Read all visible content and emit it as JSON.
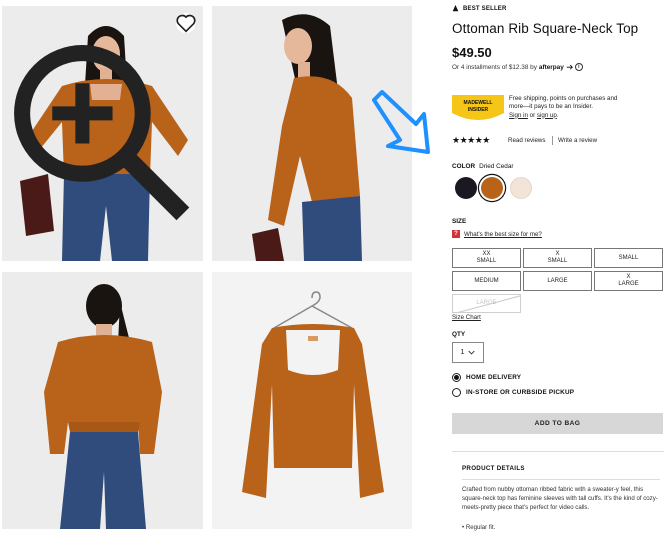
{
  "gallery": {
    "favorite_icon": "heart-icon",
    "zoom_icon": "zoom-in-icon"
  },
  "product": {
    "badge": "BEST SELLER",
    "title": "Ottoman Rib Square-Neck Top",
    "price": "$49.50",
    "installments_text": "Or 4 installments of $12.38 by",
    "afterpay": "afterpay",
    "info_icon": "i"
  },
  "insider": {
    "badge_line1": "MADEWELL",
    "badge_line2": "INSIDER",
    "text": "Free shipping, points on purchases and more—it pays to be an Insider.",
    "signin": "Sign in",
    "or": "or",
    "signup": "sign up",
    "period": "."
  },
  "reviews": {
    "rating": 4.5,
    "stars": "★★★★★",
    "read_label": "Read reviews",
    "write_label": "Write a review"
  },
  "color": {
    "label": "COLOR",
    "selected": "Dried Cedar",
    "swatches": [
      "#1c1822",
      "#b8621a",
      "#f3e4d8"
    ]
  },
  "size": {
    "label": "SIZE",
    "help_icon": "?",
    "help": "What's the best size for me?",
    "options": [
      "XX\nSMALL",
      "X\nSMALL",
      "SMALL",
      "MEDIUM",
      "LARGE",
      "X\nLARGE",
      "LARGE"
    ],
    "chart_link": "Size Chart"
  },
  "qty": {
    "label": "QTY",
    "value": "1"
  },
  "delivery": {
    "home": "HOME DELIVERY",
    "pickup": "IN-STORE OR CURBSIDE PICKUP"
  },
  "cta": {
    "add_to_bag": "ADD TO BAG"
  },
  "details": {
    "heading": "PRODUCT DETAILS",
    "text": "Crafted from nubby ottoman ribbed fabric with a sweater-y feel, this square-neck top has feminine sleeves with tall cuffs. It's the kind of cozy-meets-pretty piece that's perfect for video calls.",
    "bullet": "• Regular fit."
  },
  "colors": {
    "insider_yellow": "#f5c518",
    "arrow_blue": "#1e90ff",
    "sweater_rust": "#b8621a"
  }
}
